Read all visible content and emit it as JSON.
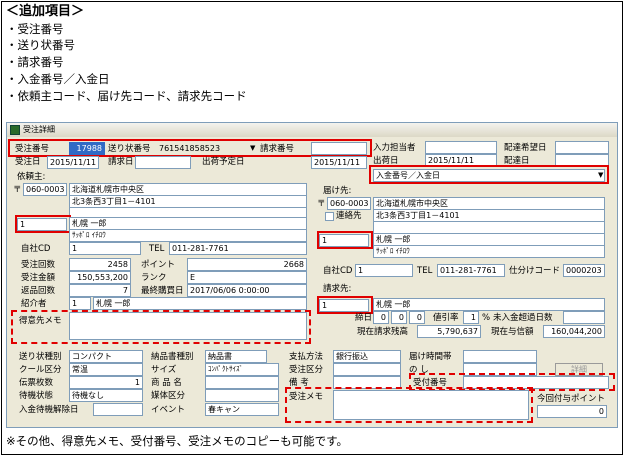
{
  "notes": {
    "heading": "＜追加項目＞",
    "items": [
      "・受注番号",
      "・送り状番号",
      "・請求番号",
      "・入金番号／入金日",
      "・依頼主コード、届け先コード、請求先コード"
    ],
    "footer": "※その他、得意先メモ、受付番号、受注メモのコピーも可能です。"
  },
  "window": {
    "title": "受注詳細"
  },
  "top": {
    "order_no_label": "受注番号",
    "order_no": "17988",
    "waybill_label": "送り状番号",
    "waybill": "761541858523",
    "invoice_label": "請求番号",
    "invoice": "",
    "order_date_label": "受注日",
    "order_date": "2015/11/11",
    "billing_date_label": "請求日",
    "billing_date": "",
    "ship_sched_label": "出荷予定日",
    "ship_sched": "2015/11/11",
    "staff_label": "入力担当者",
    "staff": "",
    "desired_label": "配達希望日",
    "desired": "",
    "ship_date_label": "出荷日",
    "ship_date": "2015/11/11",
    "delivery_label": "配達日",
    "delivery": "",
    "payment_select": "入金番号／入金日"
  },
  "client": {
    "section": "依頼主:",
    "zip_mark": "〒",
    "zip": "060-0003",
    "addr1": "北海道札幌市中央区",
    "addr2": "北3条西3丁目1－4101",
    "code": "1",
    "name": "札幌 一郎",
    "kana": "ｻｯﾎﾟﾛ ｲﾁﾛｳ",
    "cd_label": "自社CD",
    "cd": "1",
    "tel_label": "TEL",
    "tel": "011-281-7761",
    "count_label": "受注回数",
    "count": "2458",
    "points_label": "ポイント",
    "points": "2668",
    "amount_label": "受注金額",
    "amount": "150,553,200",
    "rank_label": "ランク",
    "rank": "E",
    "returns_label": "返品回数",
    "returns": "7",
    "last_label": "最終購買日",
    "last": "2017/06/06 0:00:00",
    "referrer_label": "紹介者",
    "referrer_code": "1",
    "referrer_name": "札幌 一郎",
    "memo_label": "得意先メモ"
  },
  "ship_to": {
    "section": "届け先:",
    "zip_mark": "〒",
    "zip": "060-0003",
    "addr1": "北海道札幌市中央区",
    "addr2": "北3条西3丁目1－4101",
    "contact_label": "連絡先",
    "code": "1",
    "name": "札幌 一郎",
    "kana": "ｻｯﾎﾟﾛ ｲﾁﾛｳ",
    "cd_label": "自社CD",
    "cd": "1",
    "tel_label": "TEL",
    "tel": "011-281-7761",
    "sort_label": "仕分けコード",
    "sort": "0000203"
  },
  "bill_to": {
    "section": "請求先:",
    "code": "1",
    "name": "札幌 一郎",
    "closing_label": "締日",
    "closing": "0",
    "c2": "0",
    "c3": "0",
    "discount_label": "値引率",
    "discount": "1",
    "pct": "%",
    "overdue_label": "未入金超過日数",
    "overdue": "",
    "balance_label": "現在請求残高",
    "balance": "5,790,637",
    "credit_label": "現在与信額",
    "credit": "160,044,200"
  },
  "bottom": {
    "r1": [
      {
        "label": "送り状種別",
        "value": "コンパクト"
      },
      {
        "label": "納品書種別",
        "value": "納品書"
      },
      {
        "label": "支払方法",
        "value": "銀行振込"
      },
      {
        "label": "届け時間帯",
        "value": ""
      }
    ],
    "r2": [
      {
        "label": "クール区分",
        "value": "常温"
      },
      {
        "label": "サイズ",
        "value": "ｺﾝﾊﾟｸﾄｻｲｽﾞ"
      },
      {
        "label": "受注区分",
        "value": ""
      },
      {
        "label": "の し",
        "value": ""
      }
    ],
    "r3": [
      {
        "label": "伝票枚数",
        "value": "1"
      },
      {
        "label": "商 品 名",
        "value": ""
      },
      {
        "label": "備 考",
        "value": ""
      },
      {
        "label": "受付番号",
        "value": ""
      }
    ],
    "r4": [
      {
        "label": "待機状態",
        "value": "待機なし"
      },
      {
        "label": "媒体区分",
        "value": ""
      }
    ],
    "r5": [
      {
        "label": "入金待機解除日",
        "value": ""
      },
      {
        "label": "イベント",
        "value": "春キャン"
      }
    ],
    "detail_btn": "詳細",
    "memo_label": "受注メモ",
    "this_points_label": "今回付与ポイント",
    "this_points": "0"
  }
}
